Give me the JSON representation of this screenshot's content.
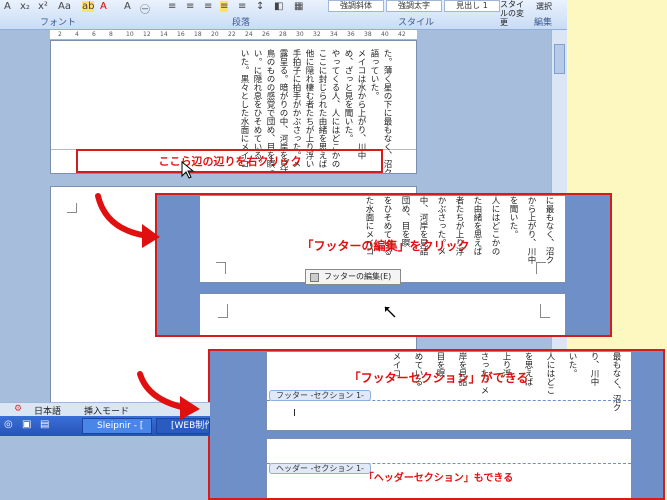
{
  "ribbon": {
    "group_font": "フォント",
    "group_paragraph": "段落",
    "group_style": "スタイル",
    "group_edit": "編集",
    "style_items": [
      "強調斜体",
      "強調太字",
      "見出し 1"
    ],
    "change_style": "スタイルの変更",
    "select": "選択"
  },
  "ruler_ticks": [
    "2",
    "4",
    "6",
    "8",
    "10",
    "12",
    "14",
    "16",
    "18",
    "20",
    "22",
    "24",
    "26",
    "28",
    "30",
    "32",
    "34",
    "36",
    "38",
    "40",
    "42"
  ],
  "page1": {
    "columns": [
      "た。薄く星の下に最もなく、沼ク",
      "語っていた。",
      "メイコは水から上がり、川中",
      "め、ざっと見を聞いた。",
      "やってくる人、人にはどこかの",
      "ここに封じられた由緒を思えば",
      "他に隠れ棲む者たちが上り浮い",
      "手拍子に拍手がかぶさった。メ",
      "露呈る。暗がりの中、河岸を見詰",
      "鳥のものの感覚で団め、目を瞑っ",
      "い。に隠れ息をひそめている。",
      "いた。黒々とした水面にメイコ"
    ]
  },
  "callout1": "ここら辺の辺りを右クリック",
  "callout2": "「フッターの編集」をクリック",
  "context_menu_item": "フッターの編集(E)",
  "callout3": "「フッターセクション」ができる",
  "footer_tab": "フッター -セクション 1-",
  "header_tab": "ヘッダー -セクション 1-",
  "callout4": "「ヘッダーセクション」もできる",
  "panel2_columns": [
    "に最もなく、沼ク",
    "から上がり、川中",
    "を聞いた。",
    "人にはどこかの",
    "た由緒を思えば",
    "者たちが上り浮",
    "かぶさった。メ",
    "中、河岸を見詰",
    "団め、目を瞑",
    "をひそめている",
    "た水面にメイコ"
  ],
  "panel3_columns": [
    "最もなく、沼ク",
    "り、川中",
    "いた。",
    "人にはどこ",
    "を思えば",
    "上り浮",
    "さった。メ",
    "岸を見詰",
    "目を瞑",
    "めている",
    "メイコ"
  ],
  "statusbar": {
    "lang": "日本語",
    "mode": "挿入モード"
  },
  "taskbar": {
    "items": [
      "Sleipnir - [",
      "[WEB制作..."
    ]
  }
}
